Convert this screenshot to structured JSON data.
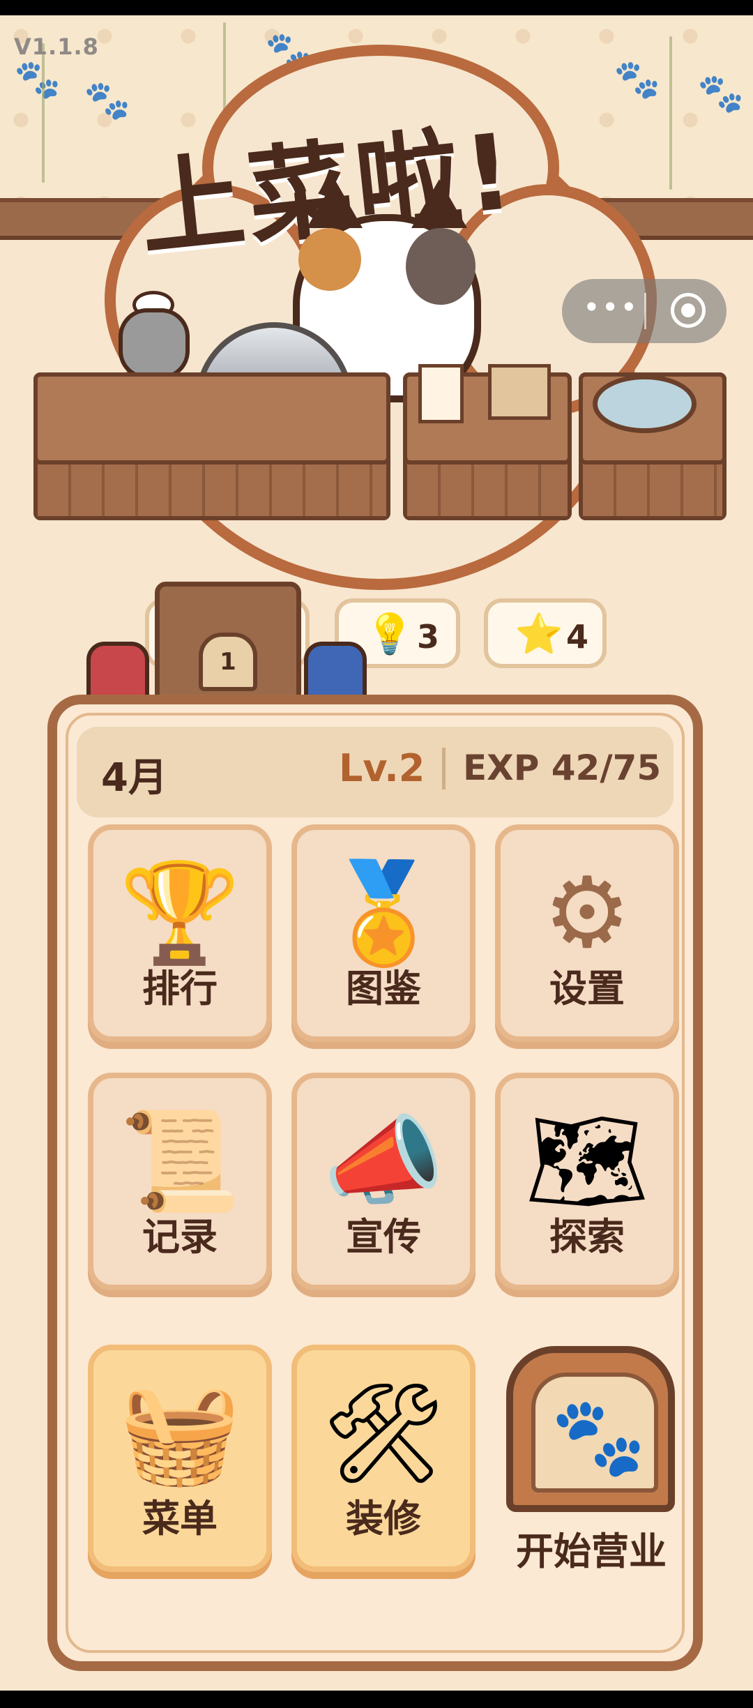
{
  "version": "V1.1.8",
  "game_title": "上菜啦!",
  "door_number": "1",
  "resources": [
    {
      "icon": "lightbulb-icon",
      "glyph": "💡",
      "value": "3"
    },
    {
      "icon": "star-icon",
      "glyph": "⭐",
      "value": "4"
    }
  ],
  "status": {
    "month": "4月",
    "level": "Lv.2",
    "exp": "EXP 42/75"
  },
  "menu": {
    "rank": {
      "label": "排行",
      "icon": "trophy-icon",
      "glyph": "🏆"
    },
    "collection": {
      "label": "图鉴",
      "icon": "medal-icon",
      "glyph": "🏅"
    },
    "settings": {
      "label": "设置",
      "icon": "gear-icon",
      "glyph": "⚙"
    },
    "records": {
      "label": "记录",
      "icon": "scroll-icon",
      "glyph": "📜"
    },
    "promote": {
      "label": "宣传",
      "icon": "megaphone-icon",
      "glyph": "📣"
    },
    "explore": {
      "label": "探索",
      "icon": "map-icon",
      "glyph": "🗺"
    },
    "dishes": {
      "label": "菜单",
      "icon": "basket-icon",
      "glyph": "🧺"
    },
    "decorate": {
      "label": "装修",
      "icon": "tools-icon",
      "glyph": "🛠"
    }
  },
  "start_button": {
    "label": "开始营业",
    "icon": "paw-icon",
    "glyph": "🐾"
  },
  "capsule": {
    "more": "•••"
  },
  "colors": {
    "accent": "#b2622e",
    "panel_border": "#a56a44",
    "text": "#4a2a1c"
  }
}
